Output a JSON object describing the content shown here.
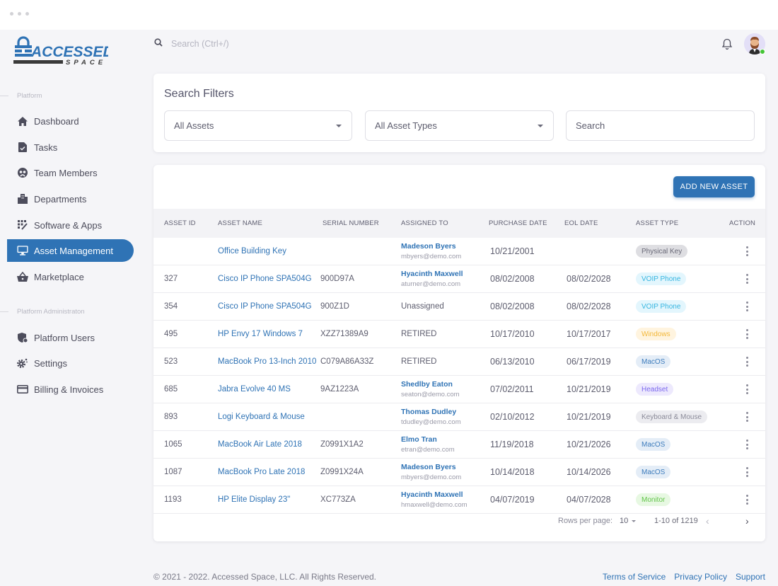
{
  "brand": {
    "name_top": "ACCESSED",
    "name_bottom": "SPACE",
    "primary_color": "#2f73b5"
  },
  "sidebar": {
    "sections": [
      {
        "label": "Platform",
        "items": [
          {
            "label": "Dashboard",
            "icon": "home-icon",
            "active": false
          },
          {
            "label": "Tasks",
            "icon": "task-file-icon",
            "active": false
          },
          {
            "label": "Team Members",
            "icon": "team-icon",
            "active": false
          },
          {
            "label": "Departments",
            "icon": "building-icon",
            "active": false
          },
          {
            "label": "Software & Apps",
            "icon": "apps-grid-icon",
            "active": false
          },
          {
            "label": "Asset Management",
            "icon": "monitor-icon",
            "active": true
          },
          {
            "label": "Marketplace",
            "icon": "basket-icon",
            "active": false
          }
        ]
      },
      {
        "label": "Platform Administraton",
        "items": [
          {
            "label": "Platform Users",
            "icon": "shield-user-icon",
            "active": false
          },
          {
            "label": "Settings",
            "icon": "gear-icon",
            "active": false
          },
          {
            "label": "Billing & Invoices",
            "icon": "credit-card-icon",
            "active": false
          }
        ]
      }
    ]
  },
  "topbar": {
    "search_placeholder": "Search (Ctrl+/)",
    "notifications_icon": "bell-icon",
    "user_status": "online"
  },
  "filters": {
    "title": "Search Filters",
    "asset_select": "All Assets",
    "type_select": "All Asset Types",
    "search_placeholder": "Search"
  },
  "table": {
    "add_button": "ADD NEW ASSET",
    "columns": [
      "ASSET ID",
      "ASSET NAME",
      "SERIAL NUMBER",
      "ASSIGNED TO",
      "PURCHASE DATE",
      "EOL DATE",
      "ASSET TYPE",
      "ACTION"
    ],
    "rows": [
      {
        "id": "",
        "name": "Office Building Key",
        "serial": "",
        "assigned": {
          "name": "Madeson Byers",
          "email": "mbyers@demo.com"
        },
        "purchase": "10/21/2001",
        "eol": "",
        "type": "Physical Key",
        "type_style": "gray"
      },
      {
        "id": "327",
        "name": "Cisco IP Phone SPA504G",
        "serial": "900D97A",
        "assigned": {
          "name": "Hyacinth Maxwell",
          "email": "aturner@demo.com"
        },
        "purchase": "08/02/2008",
        "eol": "08/02/2028",
        "type": "VOIP Phone",
        "type_style": "cyan"
      },
      {
        "id": "354",
        "name": "Cisco IP Phone SPA504G",
        "serial": "900Z1D",
        "assigned_text": "Unassigned",
        "purchase": "08/02/2008",
        "eol": "08/02/2028",
        "type": "VOIP Phone",
        "type_style": "cyan"
      },
      {
        "id": "495",
        "name": "HP Envy 17 Windows 7",
        "serial": "XZZ71389A9",
        "assigned_text": "RETIRED",
        "purchase": "10/17/2010",
        "eol": "10/17/2017",
        "type": "Windows",
        "type_style": "yellow"
      },
      {
        "id": "523",
        "name": "MacBook Pro 13-Inch 2010",
        "serial": "C079A86A33Z",
        "assigned_text": "RETIRED",
        "purchase": "06/13/2010",
        "eol": "06/17/2019",
        "type": "MacOS",
        "type_style": "blue"
      },
      {
        "id": "685",
        "name": "Jabra Evolve 40 MS",
        "serial": "9AZ1223A",
        "assigned": {
          "name": "Shedlby Eaton",
          "email": "seaton@demo.com"
        },
        "purchase": "07/02/2011",
        "eol": "10/21/2019",
        "type": "Headset",
        "type_style": "purple"
      },
      {
        "id": "893",
        "name": "Logi Keyboard & Mouse",
        "serial": "",
        "assigned": {
          "name": "Thomas Dudley",
          "email": "tdudley@demo.com"
        },
        "purchase": "02/10/2012",
        "eol": "10/21/2019",
        "type": "Keyboard & Mouse",
        "type_style": "lightgray"
      },
      {
        "id": "1065",
        "name": "MacBook Air Late 2018",
        "serial": "Z0991X1A2",
        "assigned": {
          "name": "Elmo Tran",
          "email": "etran@demo.com"
        },
        "purchase": "11/19/2018",
        "eol": "10/21/2026",
        "type": "MacOS",
        "type_style": "blue"
      },
      {
        "id": "1087",
        "name": "MacBook Pro Late 2018",
        "serial": "Z0991X24A",
        "assigned": {
          "name": "Madeson Byers",
          "email": "mbyers@demo.com"
        },
        "purchase": "10/14/2018",
        "eol": "10/14/2026",
        "type": "MacOS",
        "type_style": "blue"
      },
      {
        "id": "1193",
        "name": "HP Elite Display 23\"",
        "serial": "XC773ZA",
        "assigned": {
          "name": "Hyacinth Maxwell",
          "email": "hmaxwell@demo.com"
        },
        "purchase": "04/07/2019",
        "eol": "04/07/2028",
        "type": "Monitor",
        "type_style": "green"
      }
    ],
    "chip_styles": {
      "gray": {
        "bg": "#dedee2",
        "fg": "#6a6a78"
      },
      "lightgray": {
        "bg": "#ececf0",
        "fg": "#8a8a98"
      },
      "cyan": {
        "bg": "#e3f6fd",
        "fg": "#35b5e0"
      },
      "yellow": {
        "bg": "#fff4df",
        "fg": "#f3b83a"
      },
      "blue": {
        "bg": "#e4edf7",
        "fg": "#3d7cbc"
      },
      "purple": {
        "bg": "#ede9fd",
        "fg": "#7c69ee"
      },
      "green": {
        "bg": "#e7f8e2",
        "fg": "#62c44a"
      }
    },
    "pagination": {
      "rows_per_page_label": "Rows per page:",
      "rows_per_page": "10",
      "range": "1-10 of 1219",
      "prev": "‹",
      "next": "›"
    }
  },
  "footer": {
    "copyright": "© 2021 - 2022. Accessed Space, LLC. All Rights Reserved.",
    "links": [
      "Terms of Service",
      "Privacy Policy",
      "Support"
    ]
  }
}
